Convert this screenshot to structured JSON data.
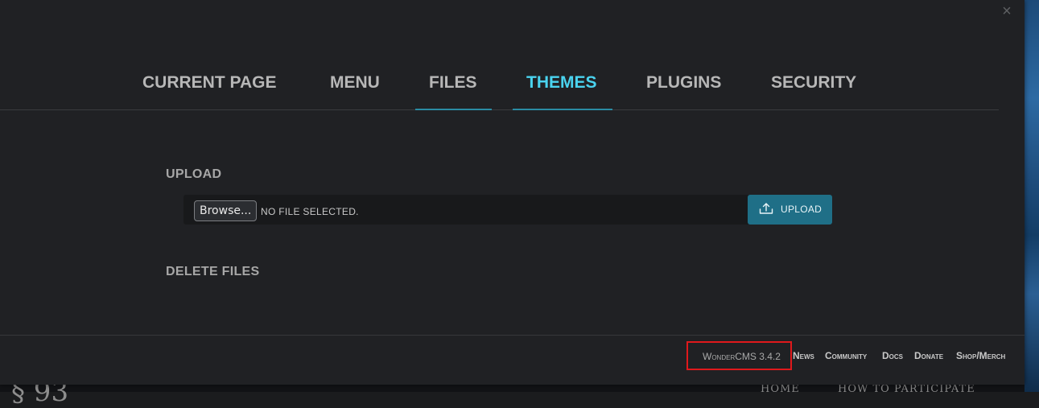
{
  "background_site": {
    "logo_fragment": "§ 93",
    "nav": [
      "HOME",
      "HOW TO PARTICIPATE"
    ]
  },
  "modal": {
    "close_icon": "×",
    "tabs": [
      {
        "label": "CURRENT PAGE"
      },
      {
        "label": "MENU"
      },
      {
        "label": "FILES"
      },
      {
        "label": "THEMES"
      },
      {
        "label": "PLUGINS"
      },
      {
        "label": "SECURITY"
      }
    ],
    "active_tab": "THEMES",
    "upload": {
      "title": "UPLOAD",
      "browse_label": "Browse...",
      "file_status": "NO FILE SELECTED.",
      "upload_button_label": "UPLOAD"
    },
    "delete": {
      "title": "DELETE FILES"
    }
  },
  "footer": {
    "version": "WonderCMS 3.4.2",
    "links": [
      {
        "label": "News"
      },
      {
        "label": "Community"
      },
      {
        "label": "Docs"
      },
      {
        "label": "Donate"
      },
      {
        "label": "Shop/Merch"
      }
    ]
  },
  "colors": {
    "accent": "#4ad3ef",
    "tab_underline": "#2a8ba3",
    "upload_button": "#1f6f87",
    "highlight_box": "#e0191c",
    "modal_bg": "#202124"
  }
}
